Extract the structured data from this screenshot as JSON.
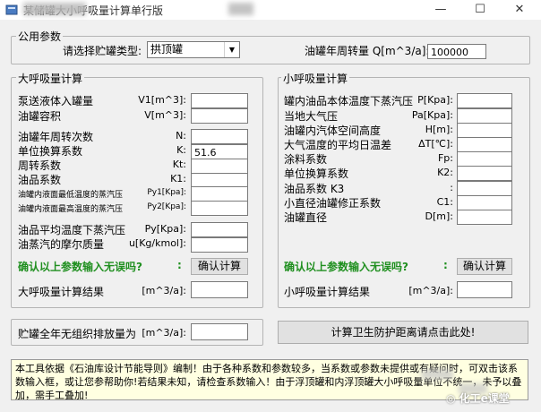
{
  "window": {
    "title": "某储罐大小呼吸量计算单行版",
    "minimize": "—",
    "maximize": "☐",
    "close": "✕"
  },
  "common": {
    "legend": "公用参数",
    "tank_type_label": "请选择贮罐类型:",
    "tank_type_value": "拱顶罐",
    "turnover_label": "油罐年周转量 Q[m^3/a]:",
    "turnover_value": "100000"
  },
  "big": {
    "legend": "大呼吸量计算",
    "rows": [
      {
        "label": "泵送液体入罐量",
        "sym": "V1[m^3]:",
        "value": ""
      },
      {
        "label": "油罐容积",
        "sym": "V[m^3]:",
        "value": ""
      },
      {
        "label": "油罐年周转次数",
        "sym": "N:",
        "value": ""
      },
      {
        "label": "单位换算系数",
        "sym": "K:",
        "value": "51.6"
      },
      {
        "label": "周转系数",
        "sym": "Kt:",
        "value": ""
      },
      {
        "label": "油品系数",
        "sym": "K1:",
        "value": ""
      },
      {
        "label": "油罐内液面最低温度的蒸汽压",
        "sym": "Py1[Kpa]:",
        "value": ""
      },
      {
        "label": "油罐内液面最高温度的蒸汽压",
        "sym": "Py2[Kpa]:",
        "value": ""
      },
      {
        "label": "油品平均温度下蒸汽压",
        "sym": "Py[Kpa]:",
        "value": ""
      },
      {
        "label": "油蒸汽的摩尔质量",
        "sym": "u[Kg/kmol]:",
        "value": ""
      }
    ],
    "confirm_text": "确认以上参数输入无误吗?",
    "confirm_colon": ":",
    "calc_button": "确认计算",
    "result_label": "大呼吸量计算结果",
    "result_unit": "[m^3/a]:",
    "result_value": ""
  },
  "small": {
    "legend": "小呼吸量计算",
    "rows": [
      {
        "label": "罐内油品本体温度下蒸汽压",
        "sym": "P[Kpa]:",
        "value": ""
      },
      {
        "label": "当地大气压",
        "sym": "Pa[Kpa]:",
        "value": ""
      },
      {
        "label": "油罐内汽体空间高度",
        "sym": "H[m]:",
        "value": ""
      },
      {
        "label": "大气温度的平均日温差",
        "sym": "ΔT[℃]:",
        "value": ""
      },
      {
        "label": "涂料系数",
        "sym": "Fp:",
        "value": ""
      },
      {
        "label": "单位换算系数",
        "sym": "K2:",
        "value": ""
      },
      {
        "label": "油品系数 K3",
        "sym": ":",
        "value": ""
      },
      {
        "label": "小直径油罐修正系数",
        "sym": "C1:",
        "value": ""
      },
      {
        "label": "油罐直径",
        "sym": "D[m]:",
        "value": ""
      }
    ],
    "confirm_text": "确认以上参数输入无误吗?",
    "confirm_colon": ":",
    "calc_button": "确认计算",
    "result_label": "小呼吸量计算结果",
    "result_unit": "[m^3/a]:",
    "result_value": ""
  },
  "annual": {
    "label": "贮罐全年无组织排放量为",
    "unit": "[m^3/a]:",
    "value": "",
    "protect_button": "计算卫生防护距离请点击此处!"
  },
  "note": "本工具依据《石油库设计节能导则》编制！由于各种系数和参数较多，当系数或参数未提供或有疑问时，可双击该系数输入框，或让您参帮助你!若结果未知，请检查系数输入！由于浮顶罐和内浮顶罐大小呼吸量单位不统一，未予以叠加，需手工叠加!",
  "brand": "化工e课堂",
  "colors": {
    "confirm_green": "#1f8f1f",
    "note_bg": "#ffffe1",
    "window_bg": "#f0f0f0"
  }
}
